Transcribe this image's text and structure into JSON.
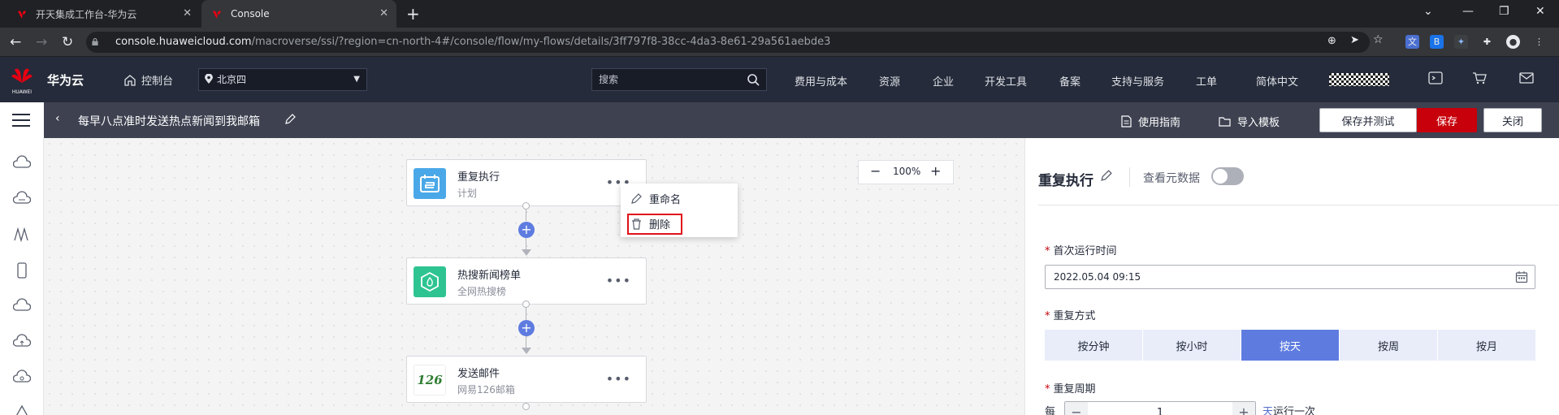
{
  "browser": {
    "tabs": [
      {
        "label": "开天集成工作台-华为云",
        "active": false
      },
      {
        "label": "Console",
        "active": true
      }
    ],
    "url_host": "console.huaweicloud.com",
    "url_path": "/macroverse/ssi/?region=cn-north-4#/console/flow/my-flows/details/3ff797f8-38cc-4da3-8e61-29a561aebde3"
  },
  "topnav": {
    "brand": "华为云",
    "logo_text": "HUAWEI",
    "console": "控制台",
    "region": "北京四",
    "search_placeholder": "搜索",
    "items": [
      "费用与成本",
      "资源",
      "企业",
      "开发工具",
      "备案",
      "支持与服务",
      "工单",
      "简体中文"
    ]
  },
  "titlebar": {
    "flow_title": "每早八点准时发送热点新闻到我邮箱",
    "guide": "使用指南",
    "import": "导入模板",
    "save_test": "保存并测试",
    "save": "保存",
    "close": "关闭"
  },
  "canvas": {
    "zoom": "100%",
    "nodes": [
      {
        "title": "重复执行",
        "subtitle": "计划",
        "icon": "calendar-icon"
      },
      {
        "title": "热搜新闻榜单",
        "subtitle": "全网热搜榜",
        "icon": "hexagon-flame-icon"
      },
      {
        "title": "发送邮件",
        "subtitle": "网易126邮箱",
        "icon": "mail-126-logo",
        "logo_text": "126"
      }
    ],
    "context_menu": {
      "rename": "重命名",
      "delete": "删除"
    }
  },
  "panel": {
    "title": "重复执行",
    "view_metadata": "查看元数据",
    "first_run_label": "首次运行时间",
    "first_run_value": "2022.05.04 09:15",
    "repeat_mode_label": "重复方式",
    "repeat_modes": [
      "按分钟",
      "按小时",
      "按天",
      "按周",
      "按月"
    ],
    "active_mode": "按天",
    "repeat_period_label": "重复周期",
    "period_prefix": "每",
    "period_value": "1",
    "period_unit": "天",
    "period_suffix": "运行一次"
  },
  "colors": {
    "accent": "#5e7ce0",
    "save_red": "#c7000b",
    "nav_bg": "#252b3a",
    "titlebar_bg": "#3d4150"
  }
}
